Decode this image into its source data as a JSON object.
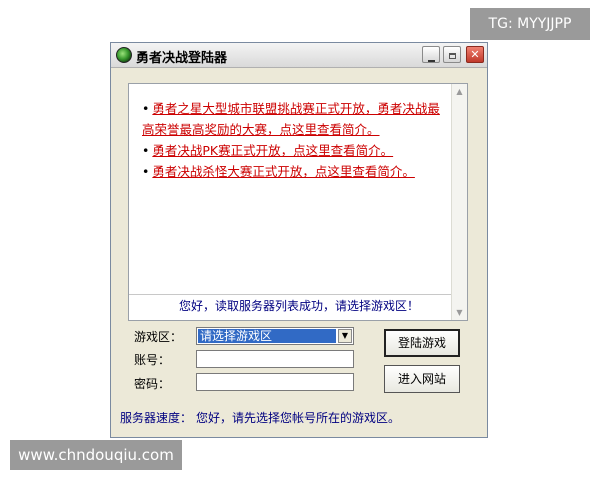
{
  "watermarks": {
    "top": "TG: MYYJJPP",
    "bottom": "www.chndouqiu.com"
  },
  "window": {
    "title": "勇者决战登陆器",
    "app_icon": "green-orb-icon",
    "controls": {
      "minimize_icon": "minimize-icon",
      "maximize_icon": "maximize-icon",
      "close_icon": "close-icon",
      "close_glyph": "✕"
    }
  },
  "news": {
    "items": [
      "勇者之星大型城市联盟挑战赛正式开放，勇者决战最高荣誉最高奖励的大赛，点这里查看简介。",
      "勇者决战PK赛正式开放，点这里查看简介。",
      "勇者决战杀怪大赛正式开放，点这里查看简介。"
    ],
    "bullet": "•",
    "scroll_up_glyph": "▲",
    "scroll_down_glyph": "▼"
  },
  "status_message": "您好，读取服务器列表成功，请选择游戏区！",
  "form": {
    "zone_label": "游戏区：",
    "zone_selected": "请选择游戏区",
    "zone_arrow_glyph": "▼",
    "account_label": "账号：",
    "account_value": "",
    "password_label": "密码：",
    "password_value": ""
  },
  "buttons": {
    "login": "登陆游戏",
    "website": "进入网站"
  },
  "server_speed": {
    "label": "服务器速度：",
    "text": "您好，请先选择您帐号所在的游戏区。"
  },
  "colors": {
    "news_link": "#cc0000",
    "status_text": "#000080",
    "selection": "#316ac5",
    "window_bg": "#ece9d8"
  }
}
